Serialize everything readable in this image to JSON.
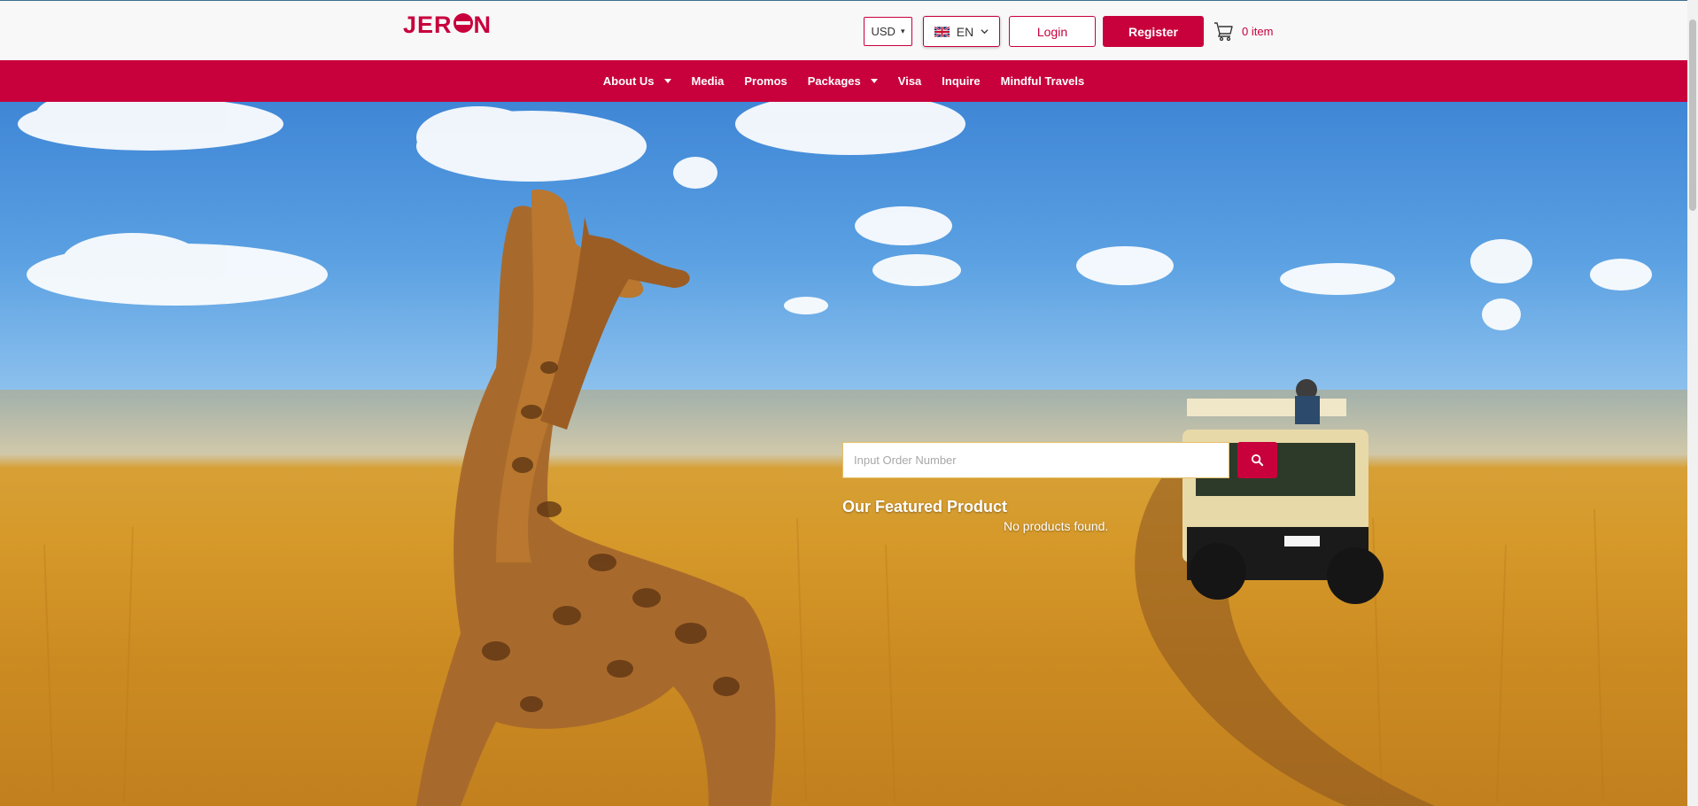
{
  "header": {
    "logo_text": "JERON",
    "currency": {
      "selected": "USD",
      "caret": "▾"
    },
    "language": {
      "selected": "EN",
      "flag": "uk-flag-icon"
    },
    "login_label": "Login",
    "register_label": "Register",
    "cart": {
      "icon": "cart-icon",
      "count_label": "0 item"
    }
  },
  "nav": {
    "items": [
      {
        "label": "About Us",
        "has_dropdown": true
      },
      {
        "label": "Media",
        "has_dropdown": false
      },
      {
        "label": "Promos",
        "has_dropdown": false
      },
      {
        "label": "Packages",
        "has_dropdown": true
      },
      {
        "label": "Visa",
        "has_dropdown": false
      },
      {
        "label": "Inquire",
        "has_dropdown": false
      },
      {
        "label": "Mindful Travels",
        "has_dropdown": false
      }
    ]
  },
  "hero": {
    "search": {
      "placeholder": "Input Order Number",
      "value": "",
      "icon": "search-icon"
    },
    "featured_title": "Our Featured Product",
    "empty_message": "No products found."
  },
  "colors": {
    "brand": "#c8003c",
    "header_bg": "#f8f8f8",
    "text_on_brand": "#ffffff"
  }
}
